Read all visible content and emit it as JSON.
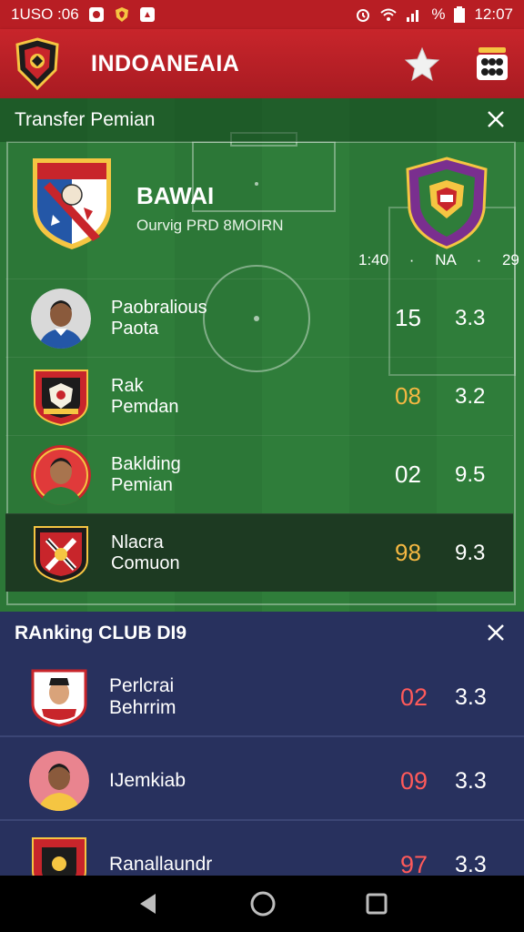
{
  "status_bar": {
    "left_text": "1USO :06",
    "time": "12:07",
    "right_text": "%"
  },
  "app_bar": {
    "title": "INDOANEAIA",
    "star_icon": "star-icon",
    "more_icon": "grid-menu-icon"
  },
  "transfer": {
    "header": "Transfer Pemian",
    "match": {
      "name": "BAWAI",
      "subtitle": "Ourvig PRD 8MOIRN",
      "stats": "1:40 · NA · 29"
    },
    "rows": [
      {
        "line1": "Paobralious",
        "line2": "Paota",
        "number": "15",
        "value": "3.3",
        "highlight": false
      },
      {
        "line1": "Rak",
        "line2": "Pemdan",
        "number": "08",
        "value": "3.2",
        "highlight": true
      },
      {
        "line1": "Baklding",
        "line2": "Pemian",
        "number": "02",
        "value": "9.5",
        "highlight": false
      },
      {
        "line1": "Nlacra",
        "line2": "Comuon",
        "number": "98",
        "value": "9.3",
        "highlight": true
      }
    ]
  },
  "ranking": {
    "header": "RAnking CLUB DI9",
    "rows": [
      {
        "line1": "Perlcrai",
        "line2": "Behrrim",
        "number": "02",
        "value": "3.3"
      },
      {
        "line1": "IJemkiab",
        "line2": "",
        "number": "09",
        "value": "3.3"
      },
      {
        "line1": "Ranallaundr",
        "line2": "",
        "number": "97",
        "value": "3.3"
      }
    ]
  },
  "colors": {
    "app_red": "#c8252b",
    "pitch_green": "#2f7d3a",
    "ranking_navy": "#28315e",
    "gold": "#f5b842",
    "rank_red": "#ff5a5a"
  }
}
